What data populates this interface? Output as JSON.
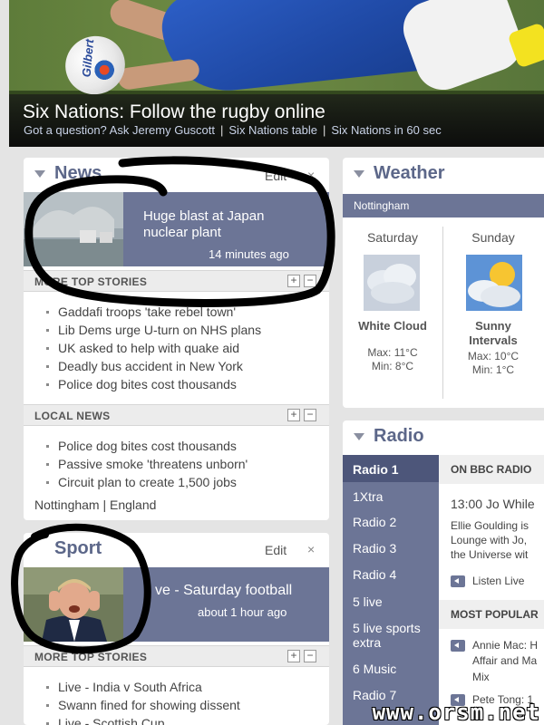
{
  "hero": {
    "title": "Six Nations: Follow the rugby online",
    "ball_brand": "Gilbert",
    "links": [
      "Got a question? Ask Jeremy Guscott",
      "Six Nations table",
      "Six Nations in 60 sec"
    ]
  },
  "news": {
    "title": "News",
    "edit_label": "Edit",
    "close_label": "×",
    "promo": {
      "text": "Huge blast at Japan nuclear plant",
      "time": "14 minutes ago"
    },
    "more_label": "MORE TOP STORIES",
    "stories": [
      "Gaddafi troops 'take rebel town'",
      "Lib Dems urge U-turn on NHS plans",
      "UK asked to help with quake aid",
      "Deadly bus accident in New York",
      "Police dog bites cost thousands"
    ],
    "local_label": "LOCAL NEWS",
    "local_stories": [
      "Police dog bites cost thousands",
      "Passive smoke 'threatens unborn'",
      "Circuit plan to create 1,500 jobs"
    ],
    "location": "Nottingham | England"
  },
  "sport": {
    "title": "Sport",
    "edit_label": "Edit",
    "close_label": "×",
    "promo": {
      "text": "ve - Saturday football",
      "time": "about 1 hour ago"
    },
    "more_label": "MORE TOP STORIES",
    "stories": [
      "Live - India v South Africa",
      "Swann fined for showing dissent",
      "Live - Scottish Cup"
    ]
  },
  "weather": {
    "title": "Weather",
    "location": "Nottingham",
    "days": [
      {
        "day": "Saturday",
        "condition": "White Cloud",
        "max": "Max: 11°C",
        "min": "Min: 8°C"
      },
      {
        "day": "Sunday",
        "condition": "Sunny Intervals",
        "max": "Max: 10°C",
        "min": "Min: 1°C"
      }
    ]
  },
  "radio": {
    "title": "Radio",
    "stations": [
      "Radio 1",
      "1Xtra",
      "Radio 2",
      "Radio 3",
      "Radio 4",
      "5 live",
      "5 live sports extra",
      "6 Music",
      "Radio 7"
    ],
    "on_bbc_label": "ON BBC RADIO",
    "now_playing": "13:00 Jo While",
    "description": [
      "Ellie Goulding is",
      "Lounge with Jo,",
      "the Universe wit"
    ],
    "listen_live": "Listen Live",
    "most_popular_label": "MOST POPULAR",
    "popular": [
      {
        "lines": [
          "Annie Mac: H",
          "Affair and Ma",
          "Mix"
        ]
      },
      {
        "lines": [
          "Pete Tong: 1"
        ]
      }
    ]
  },
  "watermark": "www.orsm.net",
  "colors": {
    "accent": "#6c7596",
    "header_text": "#5c6789",
    "background": "#e4e4e4"
  }
}
